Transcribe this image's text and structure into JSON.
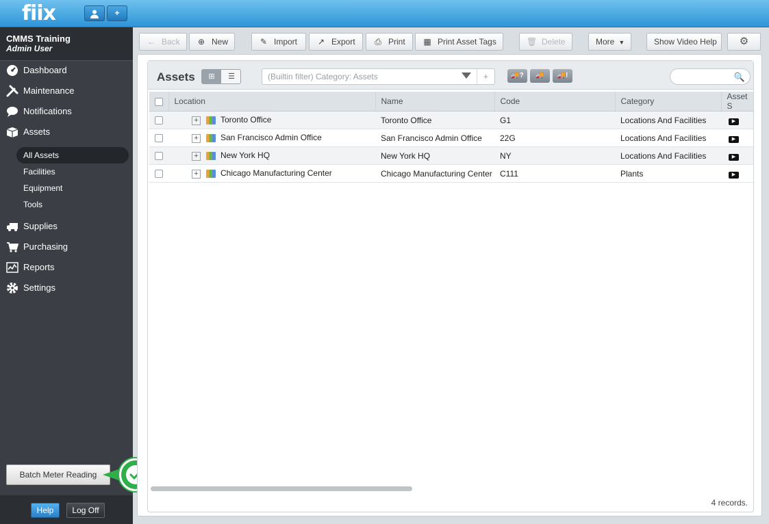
{
  "app": {
    "logo": "fiix",
    "user_icon": "user-icon",
    "add_icon": "+"
  },
  "org": {
    "name": "CMMS Training",
    "user": "Admin User"
  },
  "nav": [
    {
      "label": "Dashboard",
      "icon": "dashboard-icon"
    },
    {
      "label": "Maintenance",
      "icon": "tools-icon"
    },
    {
      "label": "Notifications",
      "icon": "speech-bubble-icon"
    },
    {
      "label": "Assets",
      "icon": "boxes-icon"
    }
  ],
  "subnav": [
    {
      "label": "All Assets",
      "active": true
    },
    {
      "label": "Facilities",
      "active": false
    },
    {
      "label": "Equipment",
      "active": false
    },
    {
      "label": "Tools",
      "active": false
    }
  ],
  "nav2": [
    {
      "label": "Supplies",
      "icon": "truck-icon"
    },
    {
      "label": "Purchasing",
      "icon": "cart-icon"
    },
    {
      "label": "Reports",
      "icon": "chart-icon"
    },
    {
      "label": "Settings",
      "icon": "gear-icon"
    }
  ],
  "batch": {
    "label": "Batch Meter Reading"
  },
  "footer": {
    "help": "Help",
    "logoff": "Log Off"
  },
  "toolbar": {
    "back": "Back",
    "new": "New",
    "import": "Import",
    "export": "Export",
    "print": "Print",
    "print_tags": "Print Asset Tags",
    "delete": "Delete",
    "more": "More",
    "video": "Show Video Help"
  },
  "list": {
    "title": "Assets",
    "filter": "(Builtin filter) Category: Assets",
    "filter_add": "+",
    "truck_buttons": [
      "?",
      "",
      "!"
    ],
    "columns": [
      "Location",
      "Name",
      "Code",
      "Category",
      "Asset S"
    ],
    "rows": [
      {
        "location": "Toronto Office",
        "name": "Toronto Office",
        "code": "G1",
        "category": "Locations And Facilities"
      },
      {
        "location": "San Francisco Admin Office",
        "name": "San Francisco Admin Office",
        "code": "22G",
        "category": "Locations And Facilities"
      },
      {
        "location": "New York HQ",
        "name": "New York HQ",
        "code": "NY",
        "category": "Locations And Facilities"
      },
      {
        "location": "Chicago Manufacturing Center",
        "name": "Chicago Manufacturing Center",
        "code": "C111",
        "category": "Plants"
      }
    ],
    "records": "4 records."
  },
  "colors": {
    "accent": "#2f95d6",
    "sidebar": "#3b3f45",
    "success": "#2fae49"
  }
}
